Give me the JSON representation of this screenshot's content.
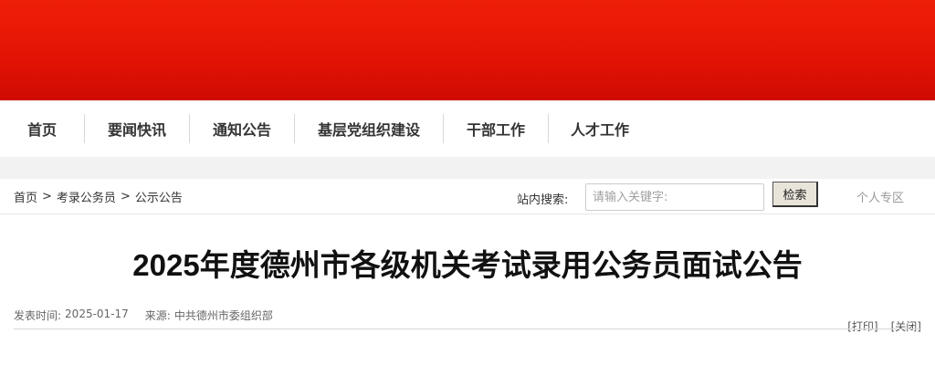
{
  "nav": {
    "items": [
      {
        "label": "首页"
      },
      {
        "label": "要闻快讯"
      },
      {
        "label": "通知公告"
      },
      {
        "label": "基层党组织建设"
      },
      {
        "label": "干部工作"
      },
      {
        "label": "人才工作"
      }
    ]
  },
  "breadcrumb": {
    "home": "首页",
    "sep": ">",
    "level1": "考录公务员",
    "level2": "公示公告"
  },
  "search": {
    "label": "站内搜索:",
    "placeholder": "请输入关键字:",
    "button": "检索"
  },
  "personal_area": "个人专区",
  "article": {
    "title": "2025年度德州市各级机关考试录用公务员面试公告",
    "published_label": "发表时间:",
    "published_date": "2025-01-17",
    "source_label": "来源:",
    "source": "中共德州市委组织部"
  },
  "tools": {
    "print": "[打印]",
    "close": "[关闭]"
  },
  "colors": {
    "banner": "#e41405",
    "nav_text": "#333333",
    "title": "#111111"
  }
}
